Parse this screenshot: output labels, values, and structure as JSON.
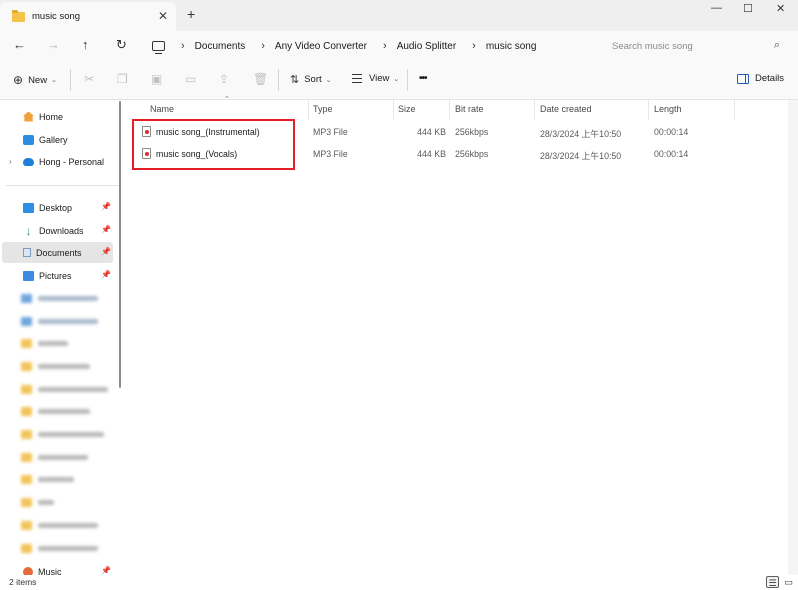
{
  "window": {
    "tab_title": "music song",
    "tab_close": "✕",
    "new_tab": "+",
    "minimize": "—",
    "maximize": "☐",
    "close": "✕"
  },
  "nav": {
    "back": "←",
    "forward": "→",
    "up": "↑",
    "refresh": "↻"
  },
  "breadcrumb": [
    "Documents",
    "Any Video Converter",
    "Audio Splitter",
    "music song"
  ],
  "search": {
    "placeholder": "Search music song"
  },
  "toolbar": {
    "new_label": "New",
    "sort_label": "Sort",
    "view_label": "View",
    "more_label": "•••",
    "details_label": "Details"
  },
  "sidebar": {
    "home": "Home",
    "gallery": "Gallery",
    "onedrive": "Hong - Personal",
    "desktop": "Desktop",
    "downloads": "Downloads",
    "documents": "Documents",
    "pictures": "Pictures",
    "music": "Music"
  },
  "columns": {
    "name": "Name",
    "type": "Type",
    "size": "Size",
    "bitrate": "Bit rate",
    "date_created": "Date created",
    "length": "Length"
  },
  "files": [
    {
      "name": "music song_(Instrumental)",
      "type": "MP3 File",
      "size": "444 KB",
      "bitrate": "256kbps",
      "date_created": "28/3/2024 上午10:50",
      "length": "00:00:14"
    },
    {
      "name": "music song_(Vocals)",
      "type": "MP3 File",
      "size": "444 KB",
      "bitrate": "256kbps",
      "date_created": "28/3/2024 上午10:50",
      "length": "00:00:14"
    }
  ],
  "status": {
    "item_count": "2 items"
  },
  "colors": {
    "highlight_box": "#e31e25",
    "accent": "#1e5fb5"
  },
  "icons": {
    "new": "plus-circle-icon",
    "cut": "scissors-icon",
    "copy": "copy-icon",
    "paste": "paste-icon",
    "rename": "rename-icon",
    "share": "share-icon",
    "delete": "trash-icon",
    "sort": "sort-icon",
    "view": "view-lines-icon",
    "details": "details-pane-icon"
  }
}
